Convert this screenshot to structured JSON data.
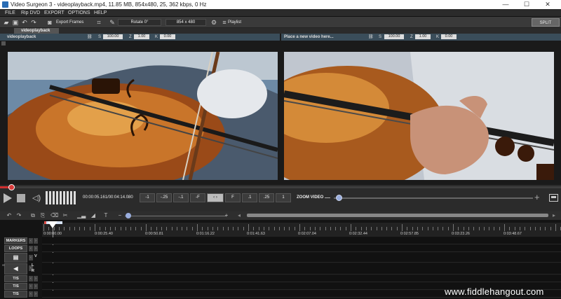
{
  "window": {
    "title": "Video Surgeon 3 - videoplayback.mp4, 11.85 MB, 854x480, 25, 362 kbps, 0 Hz",
    "minimize": "—",
    "maximize": "☐",
    "close": "✕"
  },
  "menu": [
    "FILE",
    "Rip DVD",
    "EXPORT",
    "OPTIONS",
    "HELP"
  ],
  "toolbar": {
    "export_frames": "Export Frames",
    "rotate": "Rotate 0°",
    "resolution": "854 x 480",
    "playlist": "Playlist",
    "split_screen": "SPLIT SCREEN"
  },
  "preview": {
    "tab": "videoplayback",
    "left": {
      "name": "videoplayback",
      "s": "100.00",
      "z": "1.00",
      "k": "0.00"
    },
    "right": {
      "name": "Place a new video here...",
      "s": "100.00",
      "z": "1.00",
      "k": "0.00"
    }
  },
  "playback": {
    "progress_fraction": 0.02,
    "time": "00:00:05.161/00:04:14.080",
    "steps": [
      "-1",
      "-.25",
      "-.1",
      "-F",
      "F",
      ".1",
      ".25",
      "1"
    ],
    "zoom_label": "ZOOM VIDEO"
  },
  "timeline": {
    "start_marker": "0:00:00.00",
    "labels": [
      "0:00:00.00",
      "0:00:25.40",
      "0:00:50.81",
      "0:01:16.22",
      "0:01:41.63",
      "0:02:07.04",
      "0:02:32.44",
      "0:02:57.85",
      "0:03:23.26",
      "0:03:48.67"
    ],
    "rows": {
      "markers": "MARKERS",
      "loops": "LOOPS",
      "t1": "T/S",
      "t2": "T/S",
      "t3": "T/S"
    },
    "v_label": "V",
    "l_label": "L",
    "r_label": "R"
  },
  "watermark": "www.fiddlehangout.com"
}
